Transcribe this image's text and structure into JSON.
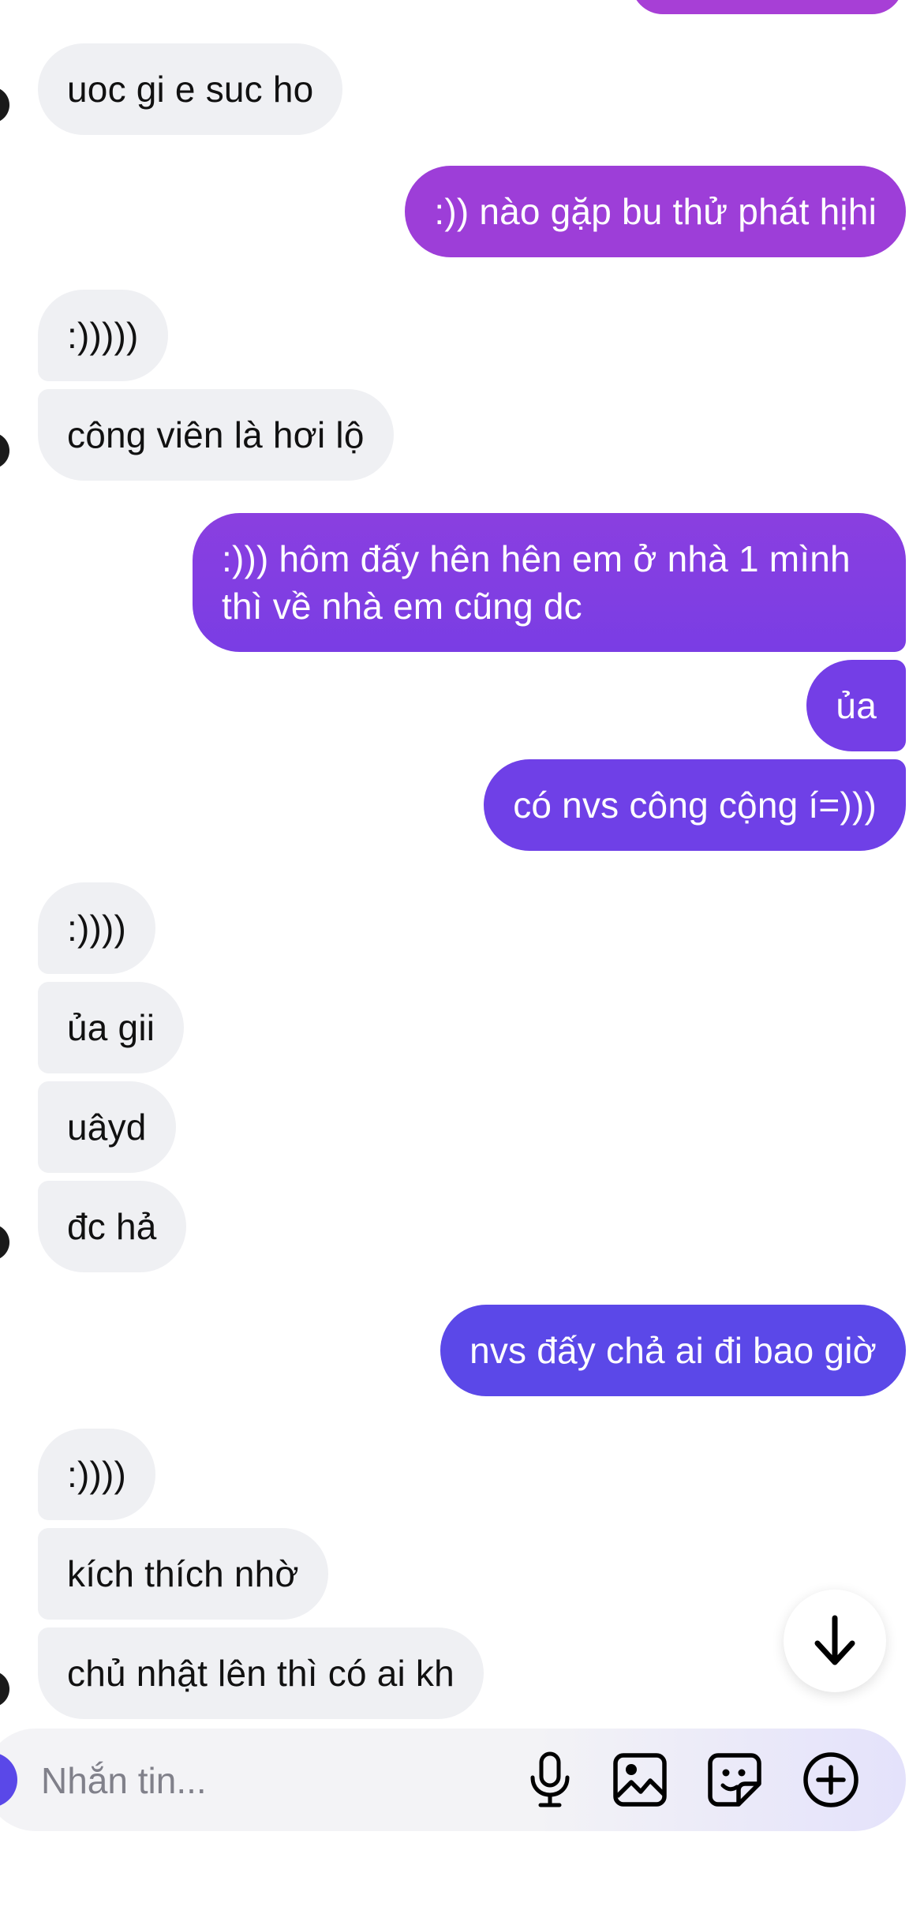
{
  "messages": [
    {
      "side": "in",
      "text": "uoc gi e suc ho"
    },
    {
      "side": "out",
      "text": ":)) nào gặp bu thử phát hịhi"
    },
    {
      "side": "in",
      "text": ":)))))"
    },
    {
      "side": "in",
      "text": "công viên là hơi lộ"
    },
    {
      "side": "out",
      "text": ":))) hôm đấy hên hên em ở nhà 1 mình thì về nhà em cũng dc"
    },
    {
      "side": "out",
      "text": "ủa"
    },
    {
      "side": "out",
      "text": "có nvs công cộng í=)))"
    },
    {
      "side": "in",
      "text": ":))))"
    },
    {
      "side": "in",
      "text": "ủa gii"
    },
    {
      "side": "in",
      "text": "uâyd"
    },
    {
      "side": "in",
      "text": "đc hả"
    },
    {
      "side": "out",
      "text": "nvs đấy chả ai đi bao giờ"
    },
    {
      "side": "in",
      "text": ":))))"
    },
    {
      "side": "in",
      "text": "kích thích nhờ"
    },
    {
      "side": "in",
      "text": "chủ nhật lên thì có ai kh"
    }
  ],
  "composer": {
    "placeholder": "Nhắn tin...",
    "icons": [
      "microphone-icon",
      "image-icon",
      "sticker-icon",
      "plus-circle-icon"
    ]
  },
  "scroll_button": {
    "icon": "arrow-down-icon"
  },
  "colors": {
    "incoming_bubble": "#eff0f3",
    "outgoing_gradient_top": "#a03ed6",
    "outgoing_gradient_bottom": "#5a48e8"
  }
}
